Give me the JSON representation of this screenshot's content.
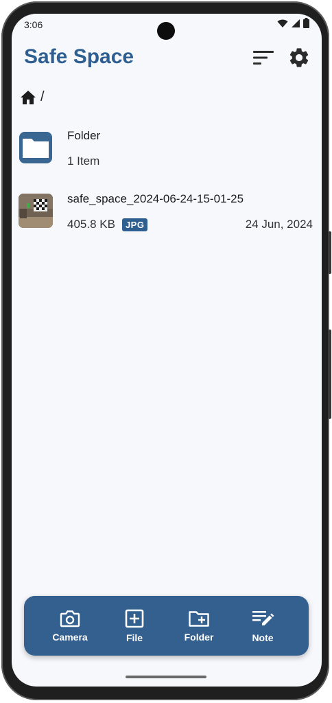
{
  "status": {
    "time": "3:06"
  },
  "app": {
    "title": "Safe Space"
  },
  "breadcrumb": {
    "separator": "/"
  },
  "items": [
    {
      "name": "Folder",
      "subtitle": "1 Item",
      "kind": "folder"
    },
    {
      "name": "safe_space_2024-06-24-15-01-25",
      "size": "405.8 KB",
      "type_badge": "JPG",
      "date": "24 Jun, 2024",
      "kind": "image"
    }
  ],
  "bottom_actions": [
    {
      "label": "Camera",
      "icon": "camera-icon"
    },
    {
      "label": "File",
      "icon": "add-box-icon"
    },
    {
      "label": "Folder",
      "icon": "create-folder-icon"
    },
    {
      "label": "Note",
      "icon": "edit-note-icon"
    }
  ],
  "colors": {
    "accent": "#2f5f91",
    "bottom_bar": "#33608f",
    "background": "#f6f8fc"
  }
}
